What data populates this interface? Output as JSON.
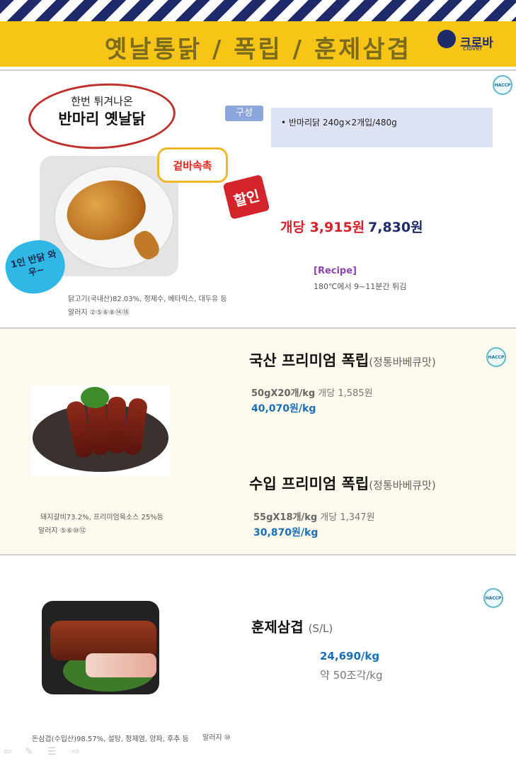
{
  "header": {
    "title": "옛날통닭 / 폭립 / 훈제삼겹",
    "logo_text": "크로바",
    "logo_sub": "clover"
  },
  "haccp_label": "HACCP",
  "section1": {
    "oval_sub": "한번 튀겨나온",
    "oval_main": "반마리 옛날닭",
    "bubble": "겉바속촉",
    "heart": "1인 반닭 와우~",
    "sale_badge": "할인",
    "composition_tag": "구성",
    "composition_item": "• 반마리닭 240g×2개입/480g",
    "price_each": "개당 3,915원",
    "price_total": "7,830원",
    "recipe_title": "[Recipe]",
    "recipe_text": "180℃에서 9~11분간 튀김",
    "ingredients": "닭고기(국내산)82.03%,  정제수, 베타믹스,  대두유 등",
    "allergens": "알러지  ②⑤⑥⑧⑭⑱"
  },
  "section2": {
    "product1": {
      "name": "국산 프리미엄 폭립",
      "flavor": "(정통바베큐맛)",
      "spec_bold": "50gX20개/kg",
      "spec_each": " 개당 1,585원",
      "price": "40,070원/kg"
    },
    "product2": {
      "name": "수입 프리미엄 폭립",
      "flavor": "(정통바베큐맛)",
      "spec_bold": "55gX18개/kg",
      "spec_each": " 개당 1,347원",
      "price": "30,870원/kg"
    },
    "ingredients": "돼지갈비73.2%, 프리미엄육소스 25%등",
    "allergens": "알러지 ⑤⑥⑩⑫"
  },
  "section3": {
    "name": "훈제삼겹",
    "size": "(S/L)",
    "price": "24,690/kg",
    "count": "약 50조각/kg",
    "ingredients": "돈삼겹(수입산)98.57%, 설탕, 정제염, 양파, 후추 등",
    "allergens": "알러지 ⑩"
  },
  "colors": {
    "banner_yellow": "#f7c515",
    "navy": "#1f2a6b",
    "red": "#d6202a",
    "blue_price": "#1a6fb5",
    "section2_bg": "#fdf9ec"
  }
}
